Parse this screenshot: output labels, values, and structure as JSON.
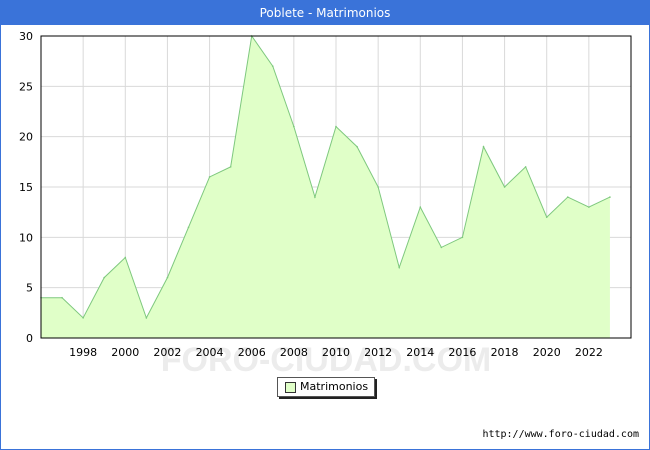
{
  "window": {
    "title": "Poblete - Matrimonios"
  },
  "watermark": "FORO-CIUDAD.COM",
  "source_url": "http://www.foro-ciudad.com",
  "colors": {
    "title_bar": "#3a73d9",
    "area_fill": "#e0ffc8",
    "line": "#7ec87e",
    "grid": "#d9d9d9"
  },
  "chart_data": {
    "type": "area",
    "title": "Poblete - Matrimonios",
    "xlabel": "",
    "ylabel": "",
    "x": [
      1996,
      1997,
      1998,
      1999,
      2000,
      2001,
      2002,
      2003,
      2004,
      2005,
      2006,
      2007,
      2008,
      2009,
      2010,
      2011,
      2012,
      2013,
      2014,
      2015,
      2016,
      2017,
      2018,
      2019,
      2020,
      2021,
      2022,
      2023
    ],
    "series": [
      {
        "name": "Matrimonios",
        "values": [
          4,
          4,
          2,
          6,
          8,
          2,
          6,
          11,
          16,
          17,
          30,
          27,
          21,
          14,
          21,
          19,
          15,
          7,
          13,
          9,
          10,
          19,
          15,
          17,
          12,
          14,
          13,
          14
        ]
      }
    ],
    "xlim": [
      1996,
      2024
    ],
    "ylim": [
      0,
      30
    ],
    "x_ticks": [
      "1998",
      "2000",
      "2002",
      "2004",
      "2006",
      "2008",
      "2010",
      "2012",
      "2014",
      "2016",
      "2018",
      "2020",
      "2022"
    ],
    "y_ticks": [
      "0",
      "5",
      "10",
      "15",
      "20",
      "25",
      "30"
    ],
    "grid": true,
    "legend_position": "bottom-center"
  }
}
